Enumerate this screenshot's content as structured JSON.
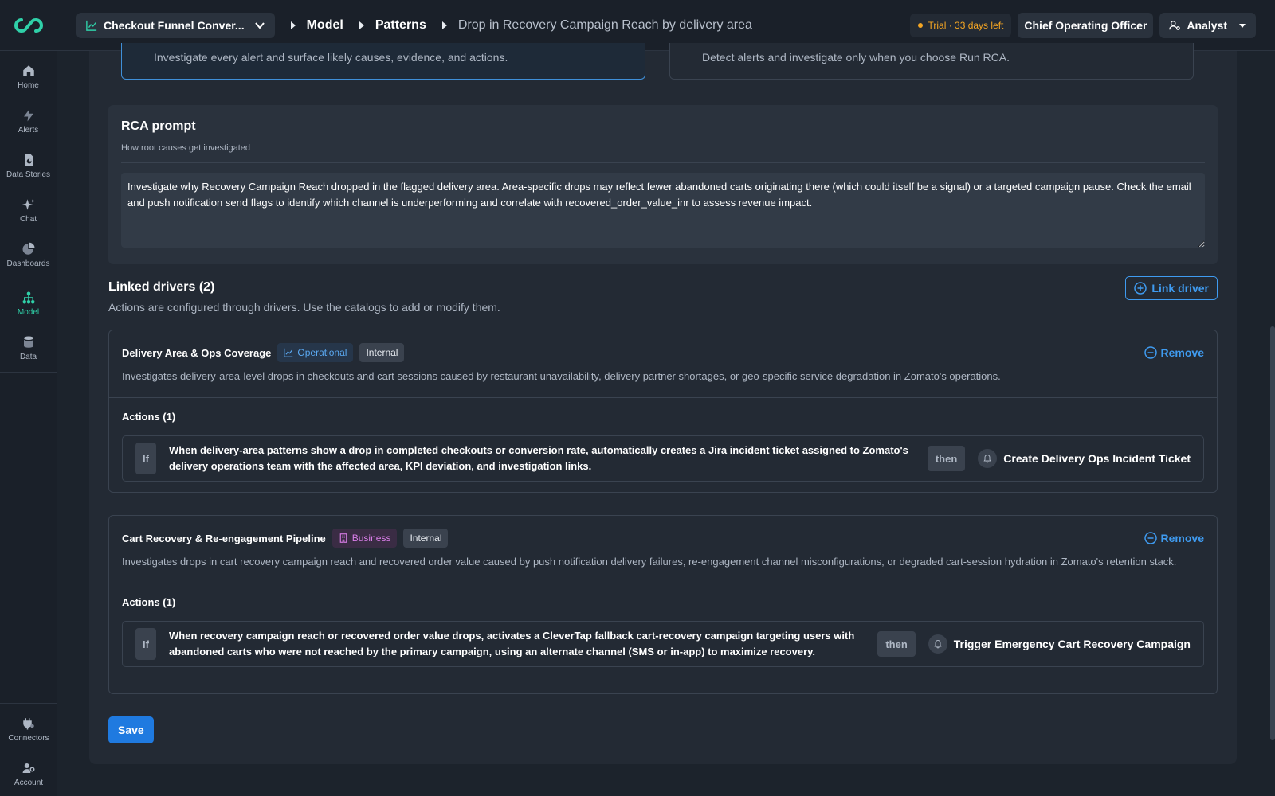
{
  "app": {
    "model_select": "Checkout Funnel Conver...",
    "breadcrumb": [
      "Model",
      "Patterns"
    ],
    "current_page": "Drop in Recovery Campaign Reach by delivery area",
    "trial": "Trial · 33 days left",
    "role": "Chief Operating Officer",
    "user": "Analyst"
  },
  "sidebar": {
    "items": [
      {
        "label": "Home",
        "icon": "home-icon"
      },
      {
        "label": "Alerts",
        "icon": "bolt-icon"
      },
      {
        "label": "Data Stories",
        "icon": "story-icon"
      },
      {
        "label": "Chat",
        "icon": "sparkle-icon"
      },
      {
        "label": "Dashboards",
        "icon": "pie-icon"
      },
      {
        "label": "Model",
        "icon": "hierarchy-icon",
        "active": true
      },
      {
        "label": "Data",
        "icon": "database-icon"
      }
    ],
    "bottom": [
      {
        "label": "Connectors",
        "icon": "plug-icon"
      },
      {
        "label": "Account",
        "icon": "user-gear-icon"
      }
    ]
  },
  "mode": {
    "option_a_desc": "Investigate every alert and surface likely causes, evidence, and actions.",
    "option_b_desc": "Detect alerts and investigate only when you choose Run RCA."
  },
  "rca": {
    "title": "RCA prompt",
    "subtitle": "How root causes get investigated",
    "prompt": "Investigate why Recovery Campaign Reach dropped in the flagged delivery area. Area-specific drops may reflect fewer abandoned carts originating there (which could itself be a signal) or a targeted campaign pause. Check the email and push notification send flags to identify which channel is underperforming and correlate with recovered_order_value_inr to assess revenue impact."
  },
  "linked": {
    "title": "Linked drivers (2)",
    "subtitle": "Actions are configured through drivers. Use the catalogs to add or modify them.",
    "link_button": "Link driver"
  },
  "drivers": [
    {
      "name": "Delivery Area & Ops Coverage",
      "category": "Operational",
      "scope": "Internal",
      "remove": "Remove",
      "description": "Investigates delivery-area-level drops in checkouts and cart sessions caused by restaurant unavailability, delivery partner shortages, or geo-specific service degradation in Zomato's operations.",
      "actions_title": "Actions (1)",
      "action": {
        "if_label": "If",
        "condition": "When delivery-area patterns show a drop in completed checkouts or conversion rate, automatically creates a Jira incident ticket assigned to Zomato's delivery operations team with the affected area, KPI deviation, and investigation links.",
        "then_label": "then",
        "name": "Create Delivery Ops Incident Ticket"
      }
    },
    {
      "name": "Cart Recovery & Re-engagement Pipeline",
      "category": "Business",
      "scope": "Internal",
      "remove": "Remove",
      "description": "Investigates drops in cart recovery campaign reach and recovered order value caused by push notification delivery failures, re-engagement channel misconfigurations, or degraded cart-session hydration in Zomato's retention stack.",
      "actions_title": "Actions (1)",
      "action": {
        "if_label": "If",
        "condition": "When recovery campaign reach or recovered order value drops, activates a CleverTap fallback cart-recovery campaign targeting users with abandoned carts who were not reached by the primary campaign, using an alternate channel (SMS or in-app) to maximize recovery.",
        "then_label": "then",
        "name": "Trigger Emergency Cart Recovery Campaign"
      }
    }
  ],
  "save_label": "Save",
  "colors": {
    "accent": "#2fd0a8",
    "primary": "#1f7ae0",
    "link": "#3f9bf0",
    "trial": "#f5a623"
  }
}
